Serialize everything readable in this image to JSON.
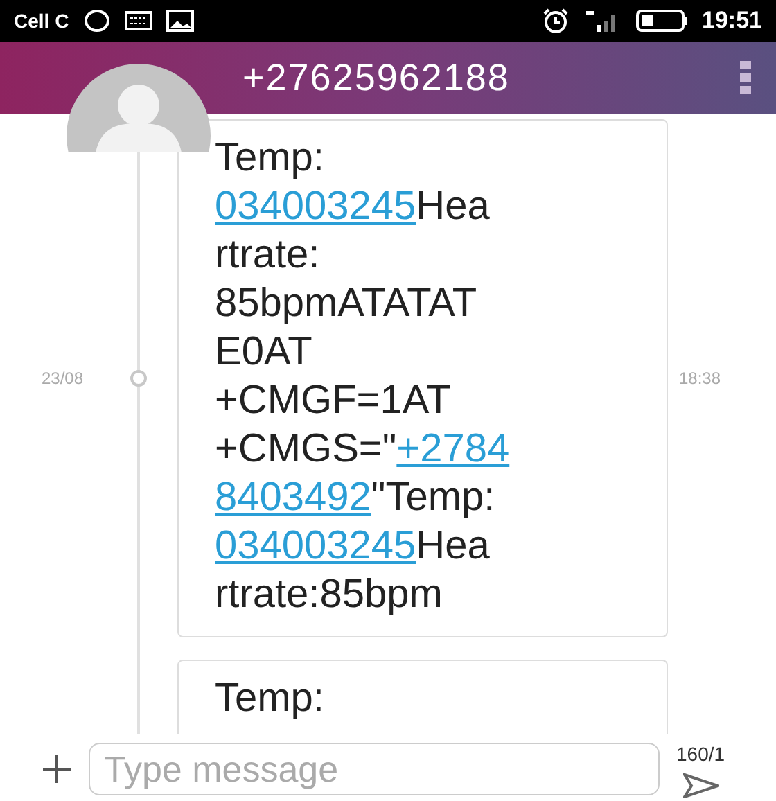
{
  "status_bar": {
    "carrier": "Cell C",
    "time": "19:51"
  },
  "header": {
    "title": "+27625962188"
  },
  "messages": [
    {
      "date": "23/08",
      "time": "18:38",
      "lines": [
        [
          {
            "text": "Temp:"
          }
        ],
        [
          {
            "text": "034003245",
            "link": true
          },
          {
            "text": "Hea"
          }
        ],
        [
          {
            "text": "rtrate:"
          }
        ],
        [
          {
            "text": "85bpmATATAT"
          }
        ],
        [
          {
            "text": "E0AT"
          }
        ],
        [
          {
            "text": "+CMGF=1AT"
          }
        ],
        [
          {
            "text": "+CMGS=\""
          },
          {
            "text": "+2784",
            "link": true
          }
        ],
        [
          {
            "text": "8403492",
            "link": true
          },
          {
            "text": "\"Temp:"
          }
        ],
        [
          {
            "text": "034003245",
            "link": true
          },
          {
            "text": "Hea"
          }
        ],
        [
          {
            "text": "rtrate:85bpm"
          }
        ]
      ]
    },
    {
      "lines": [
        [
          {
            "text": "Temp:"
          }
        ]
      ]
    }
  ],
  "composer": {
    "placeholder": "Type message",
    "counter": "160/1"
  }
}
